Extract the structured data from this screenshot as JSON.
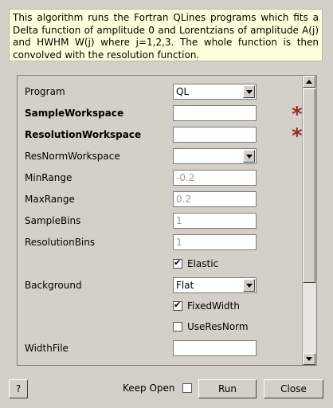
{
  "description": "This algorithm runs the Fortran QLines programs which fits a Delta function of amplitude 0 and Lorentzians of amplitude A(j) and HWHM W(j) where j=1,2,3. The whole function is then convolved with the resolution function.",
  "form": {
    "program": {
      "label": "Program",
      "value": "QL"
    },
    "sample_workspace": {
      "label": "SampleWorkspace",
      "value": ""
    },
    "resolution_workspace": {
      "label": "ResolutionWorkspace",
      "value": ""
    },
    "resnorm_workspace": {
      "label": "ResNormWorkspace",
      "value": ""
    },
    "min_range": {
      "label": "MinRange",
      "placeholder": "-0.2"
    },
    "max_range": {
      "label": "MaxRange",
      "placeholder": "0.2"
    },
    "sample_bins": {
      "label": "SampleBins",
      "placeholder": "1"
    },
    "resolution_bins": {
      "label": "ResolutionBins",
      "placeholder": "1"
    },
    "elastic": {
      "label": "Elastic",
      "checked": true
    },
    "background": {
      "label": "Background",
      "value": "Flat"
    },
    "fixed_width": {
      "label": "FixedWidth",
      "checked": true
    },
    "use_res_norm": {
      "label": "UseResNorm",
      "checked": false
    },
    "width_file": {
      "label": "WidthFile",
      "value": ""
    }
  },
  "required_marker": "*",
  "check_mark": "✔",
  "footer": {
    "help_label": "?",
    "keep_open_label": "Keep Open",
    "keep_open_checked": false,
    "run_label": "Run",
    "close_label": "Close"
  },
  "colors": {
    "required_star": "#9b2b22",
    "description_bg": "#ffffdc",
    "window_bg": "#d4d0c8"
  }
}
